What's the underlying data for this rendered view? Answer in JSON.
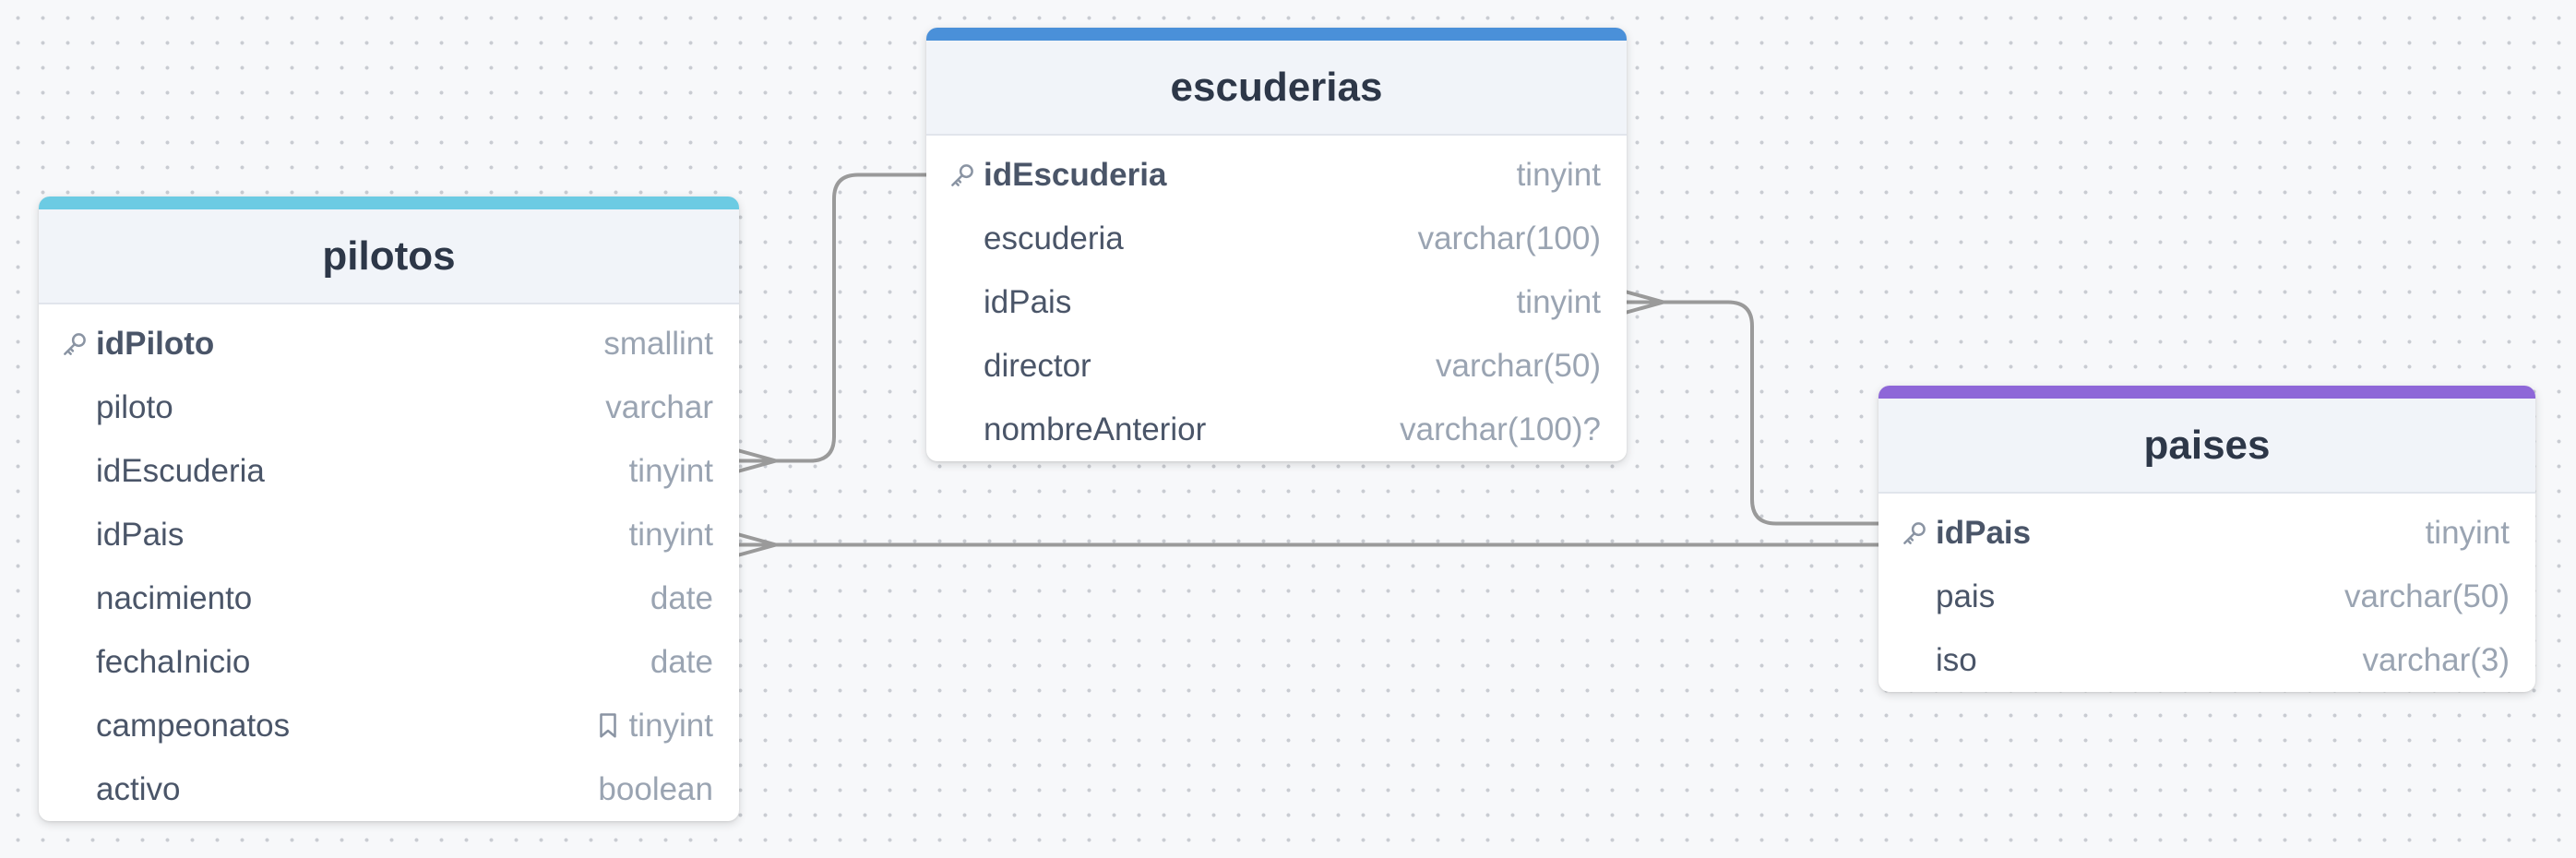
{
  "diagram": {
    "tables": [
      {
        "id": "escuderias",
        "name": "escuderias",
        "accent_color": "#4a90d9",
        "fields": [
          {
            "name": "idEscuderia",
            "type": "tinyint",
            "primary_key": true
          },
          {
            "name": "escuderia",
            "type": "varchar(100)"
          },
          {
            "name": "idPais",
            "type": "tinyint"
          },
          {
            "name": "director",
            "type": "varchar(50)"
          },
          {
            "name": "nombreAnterior",
            "type": "varchar(100)?"
          }
        ]
      },
      {
        "id": "pilotos",
        "name": "pilotos",
        "accent_color": "#6ccbe3",
        "fields": [
          {
            "name": "idPiloto",
            "type": "smallint",
            "primary_key": true
          },
          {
            "name": "piloto",
            "type": "varchar"
          },
          {
            "name": "idEscuderia",
            "type": "tinyint"
          },
          {
            "name": "idPais",
            "type": "tinyint"
          },
          {
            "name": "nacimiento",
            "type": "date"
          },
          {
            "name": "fechaInicio",
            "type": "date"
          },
          {
            "name": "campeonatos",
            "type": "tinyint",
            "has_note": true
          },
          {
            "name": "activo",
            "type": "boolean"
          }
        ]
      },
      {
        "id": "paises",
        "name": "paises",
        "accent_color": "#8e67d8",
        "fields": [
          {
            "name": "idPais",
            "type": "tinyint",
            "primary_key": true
          },
          {
            "name": "pais",
            "type": "varchar(50)"
          },
          {
            "name": "iso",
            "type": "varchar(3)"
          }
        ]
      }
    ],
    "relationships": [
      {
        "from_table": "pilotos",
        "from_field": "idEscuderia",
        "from_cardinality": "many",
        "to_table": "escuderias",
        "to_field": "idEscuderia",
        "to_cardinality": "one"
      },
      {
        "from_table": "pilotos",
        "from_field": "idPais",
        "from_cardinality": "many",
        "to_table": "paises",
        "to_field": "idPais",
        "to_cardinality": "one"
      },
      {
        "from_table": "escuderias",
        "from_field": "idPais",
        "from_cardinality": "many",
        "to_table": "paises",
        "to_field": "idPais",
        "to_cardinality": "one"
      }
    ],
    "colors": {
      "background": "#f7f8fa",
      "grid_dot": "#c9ccd2",
      "edge": "#9a9a9a",
      "header_bg": "#f1f4f9",
      "title_text": "#2d3748",
      "field_text": "#4a5568",
      "type_text": "#9aa4b2",
      "icon": "#8a94a3"
    },
    "icons": {
      "primary_key": "key-icon",
      "note": "bookmark-icon"
    }
  }
}
